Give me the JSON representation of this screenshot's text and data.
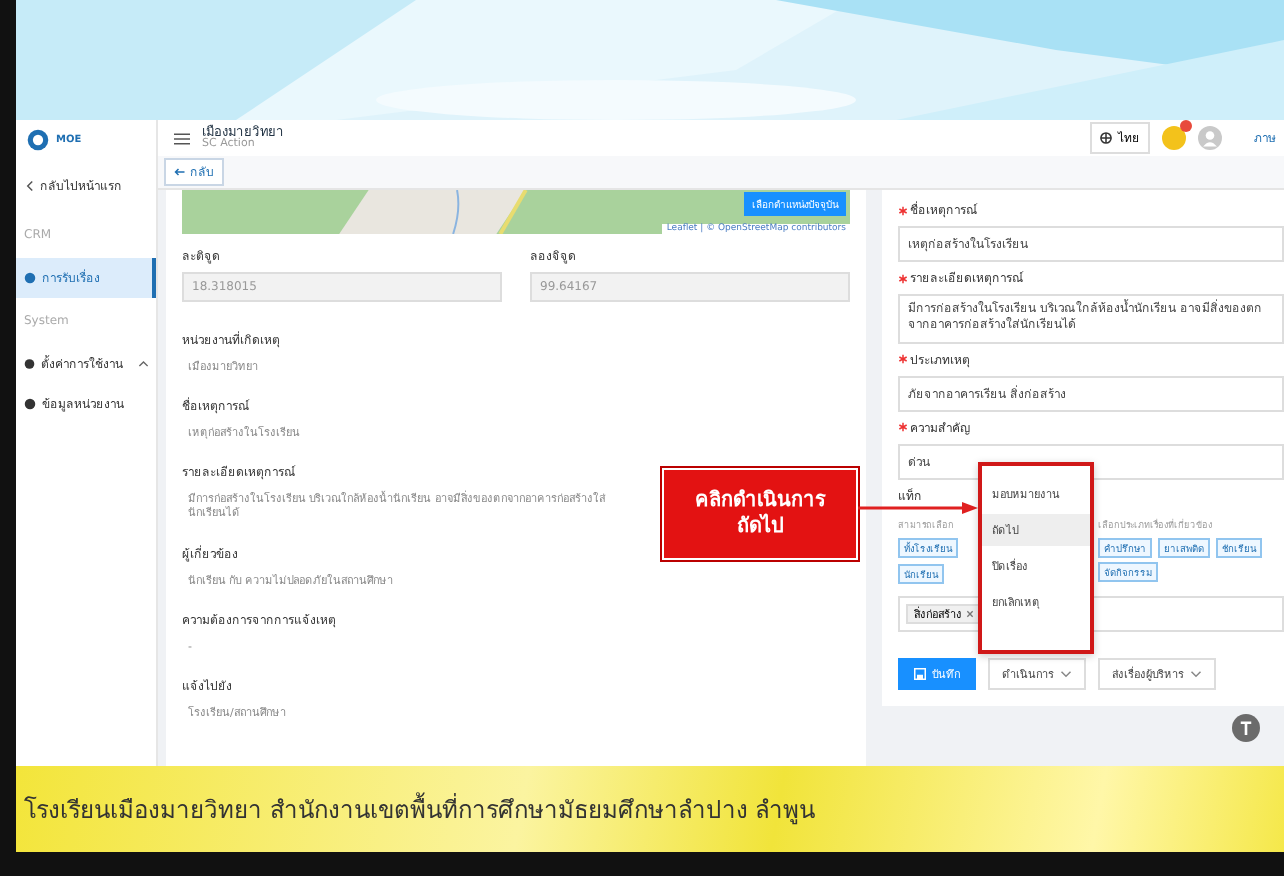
{
  "header": {
    "logo": "MOE",
    "title": "เมืองมายวิทยา",
    "subtitle": "SC Action",
    "language": "ไทย",
    "user_label": "ภาษ"
  },
  "sidebar": {
    "back_link": "กลับไปหน้าแรก",
    "items": [
      {
        "kind": "section",
        "label": "CRM"
      },
      {
        "kind": "item",
        "label": "การรับเรื่อง",
        "selected": true
      },
      {
        "kind": "section",
        "label": "System"
      },
      {
        "kind": "group",
        "label": "ตั้งค่าการใช้งาน",
        "expanded": true
      },
      {
        "kind": "item",
        "label": "ข้อมูลหน่วยงาน",
        "selected": false
      }
    ]
  },
  "toolbar": {
    "back_button": "กลับ"
  },
  "map": {
    "locate_button": "เลือกตำแหน่งปัจจุบัน",
    "attribution": "Leaflet | © OpenStreetMap contributors"
  },
  "coordinates": [
    {
      "label": "ละติจูด",
      "value": "18.318015"
    },
    {
      "label": "ลองจิจูด",
      "value": "99.64167"
    }
  ],
  "details": [
    {
      "label": "หน่วยงานที่เกิดเหตุ",
      "value": "เมืองมายวิทยา"
    },
    {
      "label": "ชื่อเหตุการณ์",
      "value": "เหตุก่อสร้างในโรงเรียน"
    },
    {
      "label": "รายละเอียดเหตุการณ์",
      "value": "มีการก่อสร้างในโรงเรียน บริเวณใกล้ห้องน้ำนักเรียน อาจมีสิ่งของตกจากอาคารก่อสร้างใส่นักเรียนได้"
    },
    {
      "label": "ผู้เกี่ยวข้อง",
      "value": "นักเรียน กับ ความไม่ปลอดภัยในสถานศึกษา"
    },
    {
      "label": "ความต้องการจากการแจ้งเหตุ",
      "value": "-"
    },
    {
      "label": "แจ้งไปยัง",
      "value": "โรงเรียน/สถานศึกษา"
    }
  ],
  "form": {
    "fields": [
      {
        "kind": "input",
        "label": "ชื่อเหตุการณ์",
        "required": true,
        "value": "เหตุก่อสร้างในโรงเรียน"
      },
      {
        "kind": "textarea",
        "label": "รายละเอียดเหตุการณ์",
        "required": true,
        "value": "มีการก่อสร้างในโรงเรียน บริเวณใกล้ห้องน้ำนักเรียน อาจมีสิ่งของตกจากอาคารก่อสร้างใส่นักเรียนได้"
      },
      {
        "kind": "input",
        "label": "ประเภทเหตุ",
        "required": true,
        "value": "ภัยจากอาคารเรียน สิ่งก่อสร้าง"
      },
      {
        "kind": "input",
        "label": "ความสำคัญ",
        "required": true,
        "value": "ด่วน"
      }
    ],
    "tags_label": "แท็ก",
    "tags_hint": "สามารถเลือก",
    "tags_hint_end": "เลือกประเภทเรื่องที่เกี่ยวข้อง",
    "tags_left": [
      "ทั้งโรงเรียน",
      "นักเรียน"
    ],
    "tags_right": [
      "คำปรึกษา",
      "ยาเสพติด",
      "ชักเรียน",
      "จัดกิจกรรม"
    ],
    "selected_tags": [
      "สิ่งก่อสร้าง"
    ],
    "save_button": "บันทึก",
    "action_button": "ดำเนินการ",
    "escalate_button": "ส่งเรื่องผู้บริหาร"
  },
  "action_menu": [
    {
      "label": "มอบหมายงาน",
      "selected": false
    },
    {
      "label": "ถัดไป",
      "selected": true
    },
    {
      "label": "ปิดเรื่อง",
      "selected": false
    },
    {
      "label": "ยกเลิกเหตุ",
      "selected": false
    }
  ],
  "callout": [
    "คลิกดำเนินการ",
    "ถัดไป"
  ],
  "footer_banner": "โรงเรียนเมืองมายวิทยา  สำนักงานเขตพื้นที่การศึกษามัธยมศึกษาลำปาง  ลำพูน"
}
